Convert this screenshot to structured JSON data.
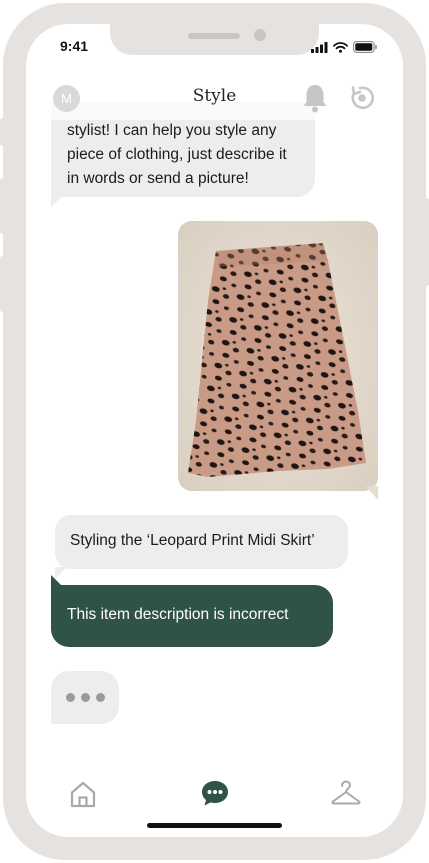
{
  "status_bar": {
    "time": "9:41"
  },
  "header": {
    "title": "Style",
    "avatar_initial": "M"
  },
  "messages": {
    "welcome": "stylist! I can help you style any piece of clothing, just describe it in words or send a picture!",
    "styling": "Styling the ‘Leopard Print Midi Skirt’",
    "incorrect": "This item description is incorrect"
  },
  "icons": {
    "bell": "bell-icon",
    "reset": "reset-icon",
    "home": "home-icon",
    "chat": "chat-icon",
    "hanger": "hanger-icon"
  },
  "colors": {
    "accent": "#2f5249",
    "bubble": "#ededed",
    "frame": "#e6e2df"
  }
}
